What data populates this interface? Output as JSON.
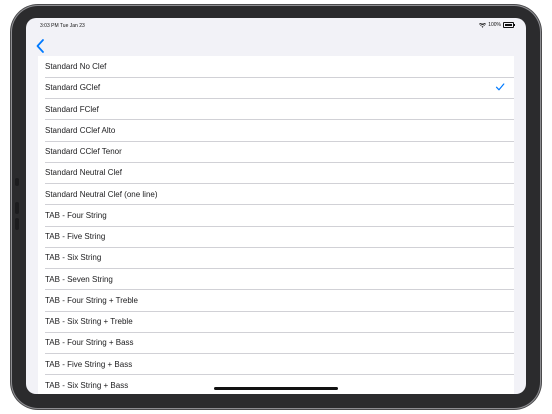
{
  "status_bar": {
    "time": "3:03 PM   Tue Jan 23",
    "battery_percent": "100%",
    "wifi_icon": "wifi-icon",
    "battery_icon": "battery-icon"
  },
  "nav": {
    "back_icon": "chevron-left-icon"
  },
  "colors": {
    "accent": "#007aff",
    "background": "#f2f2f7"
  },
  "clefs": [
    {
      "label": "Standard No Clef",
      "selected": false
    },
    {
      "label": "Standard GClef",
      "selected": true
    },
    {
      "label": "Standard FClef",
      "selected": false
    },
    {
      "label": "Standard CClef Alto",
      "selected": false
    },
    {
      "label": "Standard CClef Tenor",
      "selected": false
    },
    {
      "label": "Standard Neutral Clef",
      "selected": false
    },
    {
      "label": "Standard Neutral Clef (one line)",
      "selected": false
    },
    {
      "label": "TAB - Four String",
      "selected": false
    },
    {
      "label": "TAB - Five String",
      "selected": false
    },
    {
      "label": "TAB - Six String",
      "selected": false
    },
    {
      "label": "TAB - Seven String",
      "selected": false
    },
    {
      "label": "TAB - Four String + Treble",
      "selected": false
    },
    {
      "label": "TAB - Six String + Treble",
      "selected": false
    },
    {
      "label": "TAB - Four String + Bass",
      "selected": false
    },
    {
      "label": "TAB - Five String + Bass",
      "selected": false
    },
    {
      "label": "TAB - Six String + Bass",
      "selected": false
    }
  ]
}
